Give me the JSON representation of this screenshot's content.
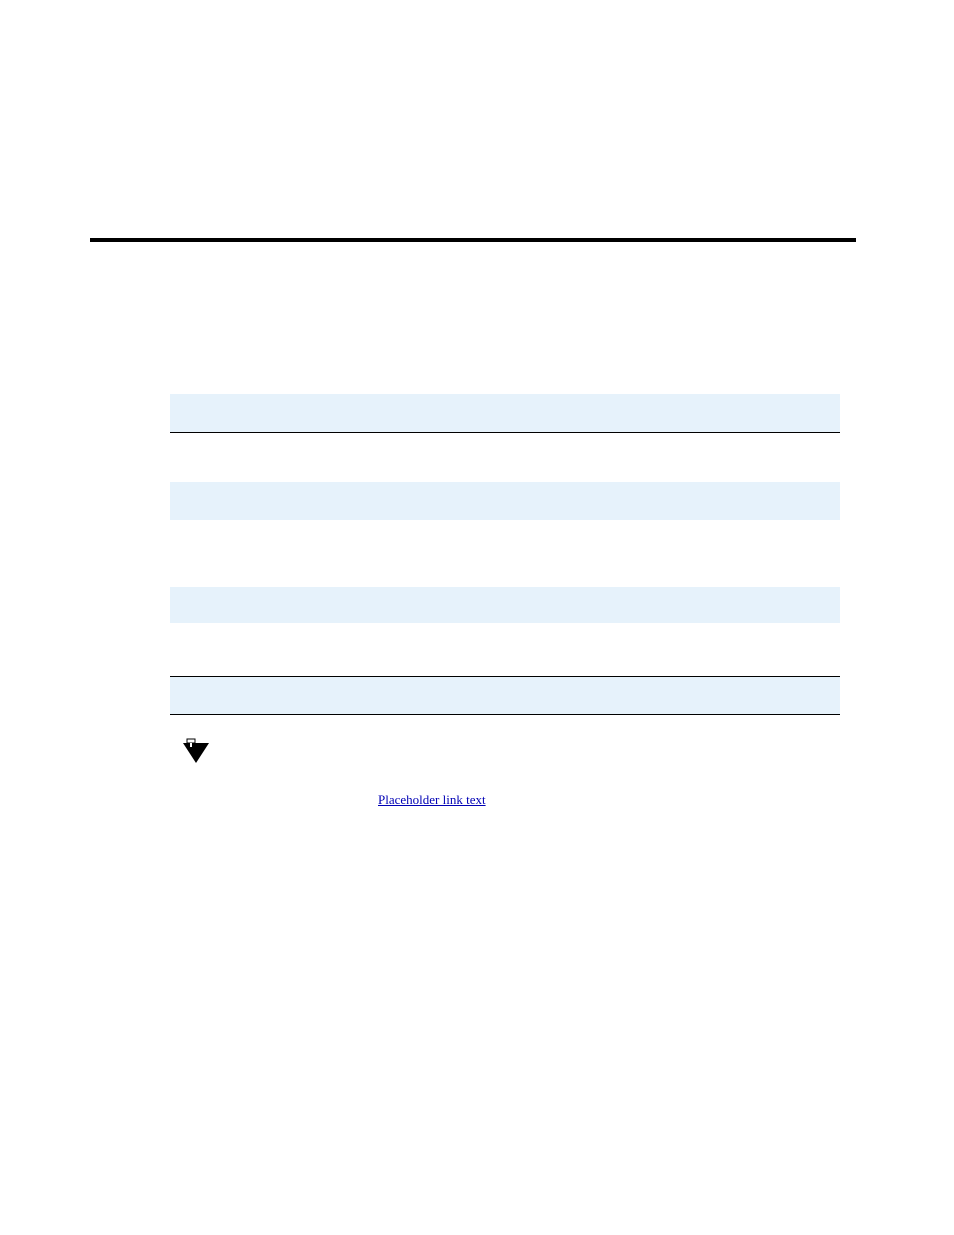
{
  "content": {
    "link_text": "Placeholder link text",
    "page_number": ""
  }
}
